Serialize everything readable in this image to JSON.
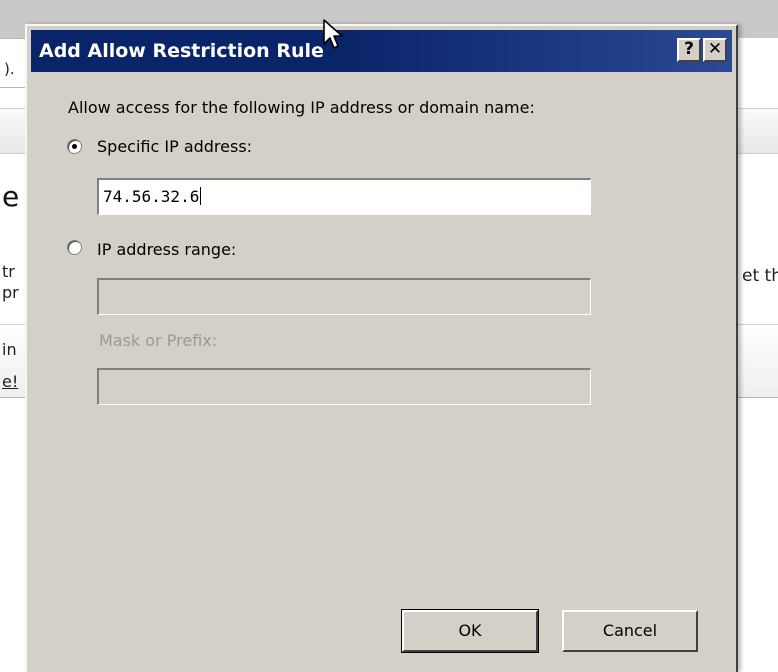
{
  "background": {
    "address_fragment": ").",
    "heading_fragment": "e",
    "line1_fragment": "tr",
    "line2_fragment": "pr",
    "right_fragment": "et th",
    "line3_fragment": "in",
    "line4_fragment": "e!"
  },
  "dialog": {
    "title": "Add Allow Restriction Rule",
    "help_button": "?",
    "close_button": "✕",
    "prompt": "Allow access for the following IP address or domain name:",
    "specific_ip": {
      "label": "Specific IP address:",
      "selected": true,
      "value": "74.56.32.6"
    },
    "ip_range": {
      "label": "IP address range:",
      "selected": false,
      "value": ""
    },
    "mask": {
      "label": "Mask or Prefix:",
      "value": ""
    },
    "ok_label": "OK",
    "cancel_label": "Cancel"
  },
  "colors": {
    "dialog_face": "#d4d0c8",
    "titlebar": "#0a246a",
    "disabled_text": "#9a9a9a"
  }
}
